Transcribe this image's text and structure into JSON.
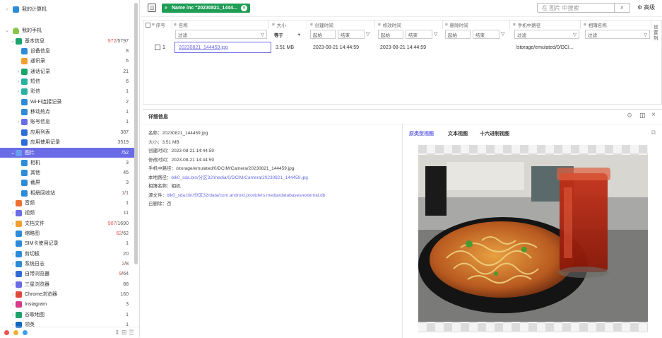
{
  "sidebar": {
    "top_item": {
      "label": "我的计算机"
    },
    "phone": {
      "label": "我的手机"
    },
    "items": [
      {
        "label": "基本信息",
        "count_red": "972",
        "count": "/5797",
        "color": "#1aa36b"
      },
      {
        "label": "设备信息",
        "count": "8",
        "color": "#2e8bd8"
      },
      {
        "label": "通讯录",
        "count": "6",
        "color": "#f0a030"
      },
      {
        "label": "通话记录",
        "count": "21",
        "color": "#1aa36b"
      },
      {
        "label": "短信",
        "count": "6",
        "color": "#2ab0a0"
      },
      {
        "label": "彩信",
        "count": "1",
        "color": "#2ab0a0"
      },
      {
        "label": "Wi-Fi连接记录",
        "count": "2",
        "color": "#2e8bd8"
      },
      {
        "label": "移动热点",
        "count": "1",
        "color": "#2e8bd8"
      },
      {
        "label": "账号信息",
        "count": "1",
        "color": "#6a6ce6"
      },
      {
        "label": "应用列表",
        "count": "387",
        "color": "#2e6bd8"
      },
      {
        "label": "应用使用记录",
        "count": "3519",
        "color": "#2e6bd8"
      },
      {
        "label": "图片",
        "count": "/52",
        "color": "#6a9ef0"
      },
      {
        "label": "相机",
        "count": "3",
        "color": "#2e8bd8"
      },
      {
        "label": "其他",
        "count": "45",
        "color": "#2e8bd8"
      },
      {
        "label": "截屏",
        "count": "3",
        "color": "#2e8bd8"
      },
      {
        "label": "相册回收站",
        "count_red": "1",
        "count": "/1",
        "color": "#2e8bd8"
      },
      {
        "label": "音频",
        "count": "1",
        "color": "#f07030"
      },
      {
        "label": "视频",
        "count": "11",
        "color": "#6a6ce6"
      },
      {
        "label": "文档文件",
        "count_red": "907",
        "count": "/1690",
        "color": "#f0a030"
      },
      {
        "label": "缩略图",
        "count_red": "62",
        "count": "/62",
        "color": "#2e8bd8"
      },
      {
        "label": "SIM卡使用记录",
        "count": "1",
        "color": "#2e8bd8"
      },
      {
        "label": "剪切板",
        "count": "20",
        "color": "#2e8bd8"
      },
      {
        "label": "系统日志",
        "count_red": "2",
        "count": "/8",
        "color": "#2e8bd8"
      },
      {
        "label": "自带浏览器",
        "count_red": "9",
        "count": "/64",
        "color": "#2e6bd8"
      },
      {
        "label": "三星浏览器",
        "count": "88",
        "color": "#6a6ce6"
      },
      {
        "label": "Chrome浏览器",
        "count": "160",
        "color": "#e04a3a"
      },
      {
        "label": "Instagram",
        "count": "3",
        "color": "#d83a8a"
      },
      {
        "label": "谷歌地图",
        "count": "1",
        "color": "#1aa36b"
      },
      {
        "label": "领英",
        "count": "1",
        "color": "#0a66c2"
      }
    ]
  },
  "toolbar": {
    "filter_tag": "Name inc \"20230821_1444...",
    "search_placeholder": "在 图片 中搜索",
    "advanced_label": "高级"
  },
  "grid": {
    "columns": [
      "序号",
      "名称",
      "大小",
      "创建时间",
      "修改时间",
      "删除时间",
      "手机中路径",
      "相簿名称"
    ],
    "filter_placeholder": "过滤",
    "size_op": "等于",
    "start": "起始",
    "end": "结束",
    "row": {
      "index": "1",
      "name": "20230821_144459.jpg",
      "size": "3.51 MB",
      "created": "2023-08-21 14:44:59",
      "modified": "2023-08-21 14:44:59",
      "path": "/storage/emulated/0/DCI..."
    },
    "side_label": "设置列"
  },
  "detail": {
    "title": "详细信息",
    "props": [
      {
        "k": "名称：",
        "v": "20230821_144459.jpg",
        "link": false
      },
      {
        "k": "大小：",
        "v": "3.51 MB",
        "link": false
      },
      {
        "k": "创建时间：",
        "v": "2023-08-21 14:44:59",
        "link": false
      },
      {
        "k": "修改时间：",
        "v": "2023-08-21 14:44:59",
        "link": false
      },
      {
        "k": "手机中路径：",
        "v": "/storage/emulated/0/DCIM/Camera/20230821_144459.jpg",
        "link": false
      },
      {
        "k": "本地路径：",
        "v": "blk0_sda.bin/分区32/media/0/DCIM/Camera/20230821_144459.jpg",
        "link": true
      },
      {
        "k": "相簿名称：",
        "v": "相机",
        "link": false
      },
      {
        "k": "源文件：",
        "v": "blk0_sda.bin/分区32/data/com.android.providers.media/databases/external.db",
        "link": true
      },
      {
        "k": "已删除：",
        "v": "否",
        "link": false
      }
    ],
    "tabs": [
      "原类型视图",
      "文本视图",
      "十六进制视图"
    ]
  }
}
